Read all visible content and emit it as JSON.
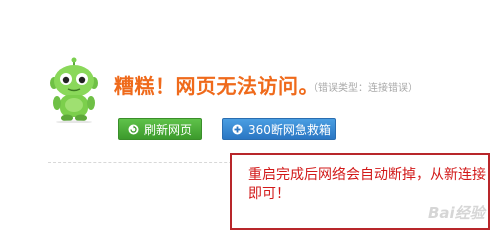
{
  "error_page": {
    "title": "糟糕！网页无法访问。",
    "error_type": "（错误类型：连接错误）",
    "buttons": {
      "refresh_label": "刷新网页",
      "rescue_label": "360断网急救箱"
    },
    "icons": {
      "mascot": "green-robot-mascot-icon",
      "refresh": "refresh-icon",
      "rescue": "plus-circle-icon"
    },
    "colors": {
      "title": "#ef6a1b",
      "refresh_button": "#4bae39",
      "rescue_button": "#3a8ad6",
      "annotation_border": "#b8262a",
      "annotation_text": "#d21a1a"
    }
  },
  "annotation": {
    "text": "重启完成后网络会自动断掉，从新连接即可！"
  },
  "watermark": {
    "text": "Bai经验"
  }
}
